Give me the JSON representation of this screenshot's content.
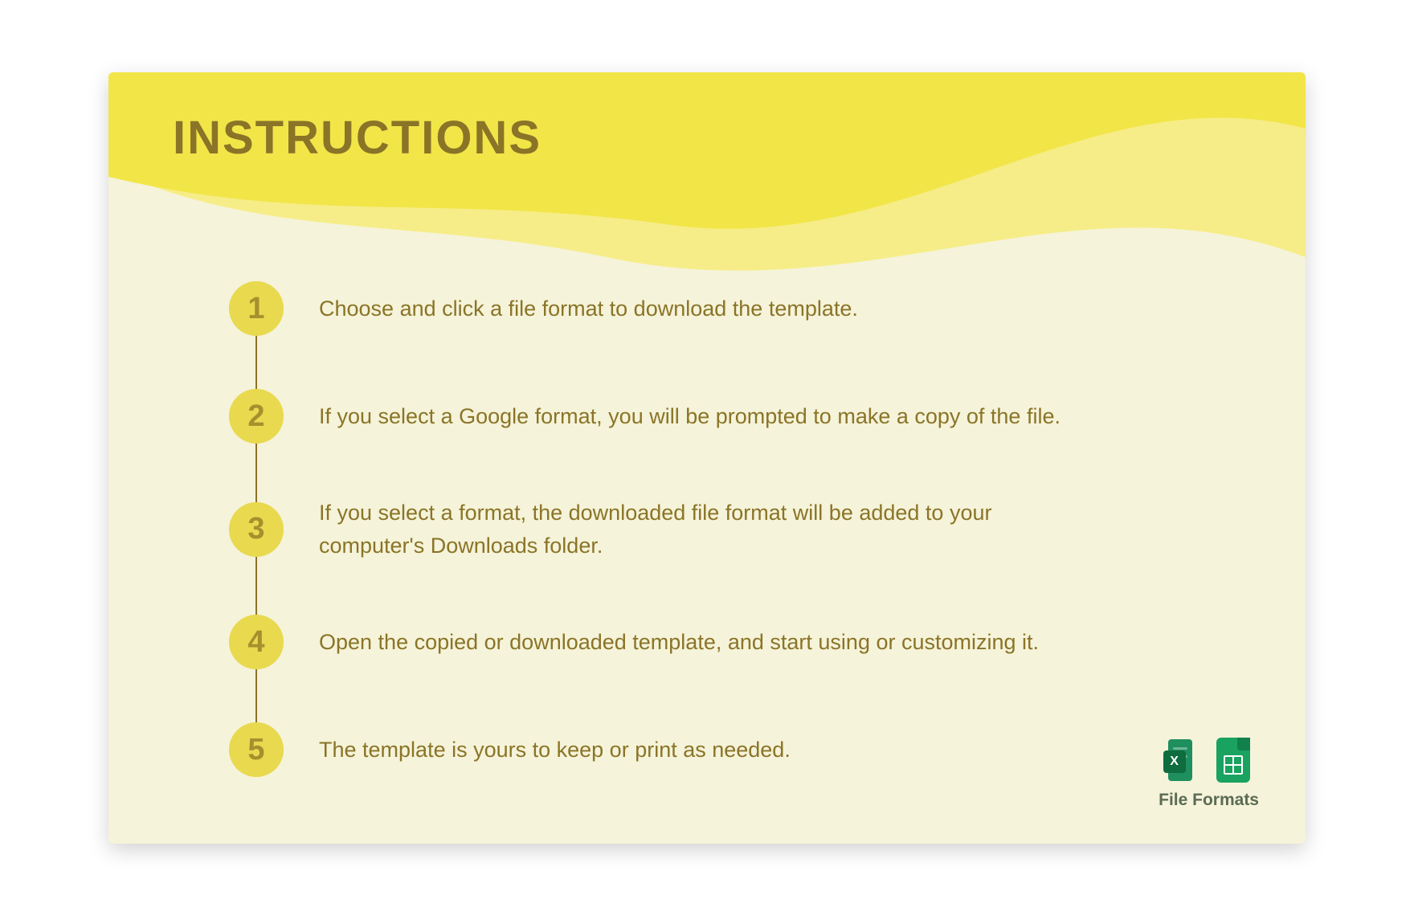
{
  "title": "INSTRUCTIONS",
  "steps": [
    {
      "n": "1",
      "text": "Choose and click a file format to download the template."
    },
    {
      "n": "2",
      "text": "If you select a Google format, you will be prompted to make a copy of the file."
    },
    {
      "n": "3",
      "text": "If you select a format, the downloaded file format will be added to your computer's Downloads folder."
    },
    {
      "n": "4",
      "text": "Open the copied or downloaded template, and start using or customizing it."
    },
    {
      "n": "5",
      "text": "The template is yours to keep or print as needed."
    }
  ],
  "formats": {
    "label": "File Formats",
    "excel_badge": "X"
  },
  "colors": {
    "wave_back": "#f6ed88",
    "wave_front": "#f2e548",
    "badge": "#e8d94f",
    "text": "#8a7427"
  }
}
